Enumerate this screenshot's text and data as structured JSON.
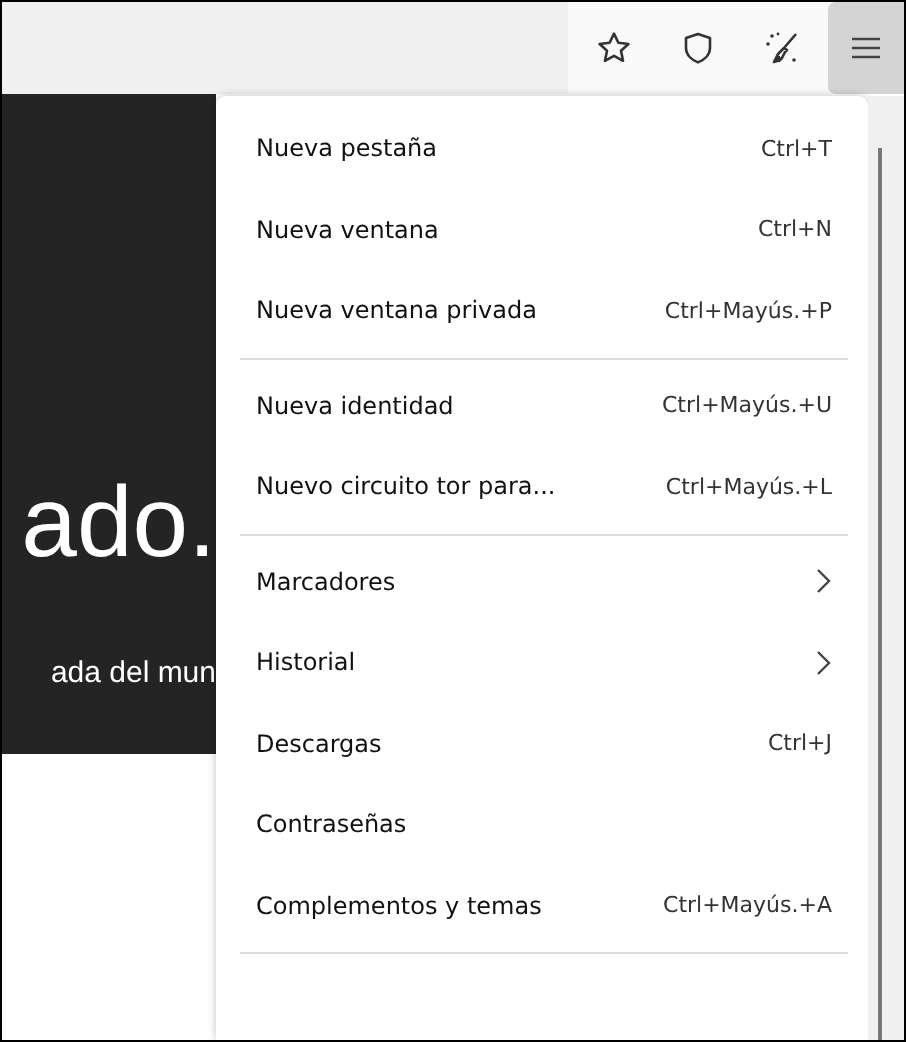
{
  "toolbar": {
    "buttons": [
      {
        "kind": "star",
        "selected": false
      },
      {
        "kind": "shield",
        "selected": false
      },
      {
        "kind": "broom",
        "selected": false
      },
      {
        "kind": "menu",
        "selected": true
      }
    ]
  },
  "page": {
    "heading": "ado.",
    "subtitle": "ada del mun"
  },
  "menu": {
    "groups": [
      {
        "items": [
          {
            "kind": "action",
            "label": "Nueva pestaña",
            "shortcut": "Ctrl+T"
          },
          {
            "kind": "action",
            "label": "Nueva ventana",
            "shortcut": "Ctrl+N"
          },
          {
            "kind": "action",
            "label": "Nueva ventana privada",
            "shortcut": "Ctrl+Mayús.+P"
          }
        ]
      },
      {
        "items": [
          {
            "kind": "action",
            "label": "Nueva identidad",
            "shortcut": "Ctrl+Mayús.+U"
          },
          {
            "kind": "action",
            "label": "Nuevo circuito tor para...",
            "shortcut": "Ctrl+Mayús.+L"
          }
        ]
      },
      {
        "items": [
          {
            "kind": "submenu",
            "label": "Marcadores"
          },
          {
            "kind": "submenu",
            "label": "Historial"
          },
          {
            "kind": "action",
            "label": "Descargas",
            "shortcut": "Ctrl+J"
          },
          {
            "kind": "action",
            "label": "Contraseñas"
          },
          {
            "kind": "action",
            "label": "Complementos y temas",
            "shortcut": "Ctrl+Mayús.+A"
          }
        ]
      }
    ]
  }
}
